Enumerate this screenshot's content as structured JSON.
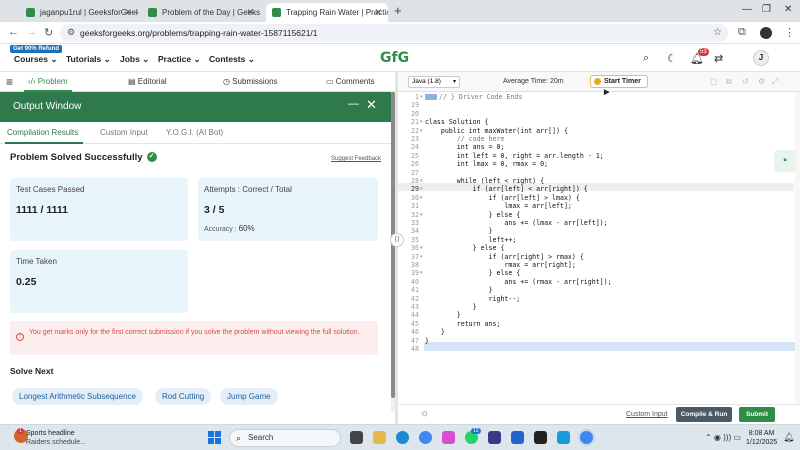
{
  "browser": {
    "tabs": [
      {
        "title": "jaganpu1rul | GeeksforGeeks Pr"
      },
      {
        "title": "Problem of the Day | GeeksforG"
      },
      {
        "title": "Trapping Rain Water | Practice"
      }
    ],
    "new_tab": "+",
    "url": "geeksforgeeks.org/problems/trapping-rain-water-1587115621/1"
  },
  "site": {
    "refund_badge": "Get 90% Refund",
    "menu": [
      "Courses",
      "Tutorials",
      "Jobs",
      "Practice",
      "Contests"
    ],
    "logo": "GfG",
    "notification_count": "53",
    "avatar_letter": "J"
  },
  "problem_toolbar": {
    "tabs": [
      "Problem",
      "Editorial",
      "Submissions",
      "Comments"
    ]
  },
  "output": {
    "title": "Output Window",
    "tabs": [
      "Compilation Results",
      "Custom Input",
      "Y.O.G.I. (AI Bot)"
    ],
    "status": "Problem Solved Successfully",
    "feedback_link": "Suggest Feedback",
    "test_cases_label": "Test Cases Passed",
    "test_cases_value": "1111 / 1111",
    "attempts_label": "Attempts : Correct / Total",
    "attempts_value": "3 / 5",
    "accuracy_label": "Accuracy :",
    "accuracy_value": "60%",
    "time_label": "Time Taken",
    "time_value": "0.25",
    "warning": "You get marks only for the first correct submission if you solve the problem without viewing the full solution.",
    "solve_next_title": "Solve Next",
    "solve_next": [
      "Longest Arithmetic Subsequence",
      "Rod Cutting",
      "Jump Game"
    ]
  },
  "editor": {
    "language": "Java (1.8)",
    "average_time": "Average Time: 20m",
    "start_timer": "Start Timer",
    "lines": [
      {
        "n": "1",
        "text": "// } Driver Code Ends",
        "cls": "cm"
      },
      {
        "n": "19",
        "text": ""
      },
      {
        "n": "20",
        "text": ""
      },
      {
        "n": "21",
        "text": "class Solution {"
      },
      {
        "n": "22",
        "text": "    public int maxWater(int arr[]) {"
      },
      {
        "n": "23",
        "text": "        // code here",
        "cls": "cm"
      },
      {
        "n": "24",
        "text": "        int ans = 0;"
      },
      {
        "n": "25",
        "text": "        int left = 0, right = arr.length - 1;"
      },
      {
        "n": "26",
        "text": "        int lmax = 0, rmax = 0;"
      },
      {
        "n": "27",
        "text": ""
      },
      {
        "n": "28",
        "text": "        while (left < right) {"
      },
      {
        "n": "29",
        "text": "            if (arr[left] < arr[right]) {"
      },
      {
        "n": "30",
        "text": "                if (arr[left] > lmax) {"
      },
      {
        "n": "31",
        "text": "                    lmax = arr[left];"
      },
      {
        "n": "32",
        "text": "                } else {"
      },
      {
        "n": "33",
        "text": "                    ans += (lmax - arr[left]);"
      },
      {
        "n": "34",
        "text": "                }"
      },
      {
        "n": "35",
        "text": "                left++;"
      },
      {
        "n": "36",
        "text": "            } else {"
      },
      {
        "n": "37",
        "text": "                if (arr[right] > rmax) {"
      },
      {
        "n": "38",
        "text": "                    rmax = arr[right];"
      },
      {
        "n": "39",
        "text": "                } else {"
      },
      {
        "n": "40",
        "text": "                    ans += (rmax - arr[right]);"
      },
      {
        "n": "41",
        "text": "                }"
      },
      {
        "n": "42",
        "text": "                right--;"
      },
      {
        "n": "43",
        "text": "            }"
      },
      {
        "n": "44",
        "text": "        }"
      },
      {
        "n": "45",
        "text": "        return ans;"
      },
      {
        "n": "46",
        "text": "    }"
      },
      {
        "n": "47",
        "text": "}"
      },
      {
        "n": "48",
        "text": ""
      }
    ],
    "custom_input": "Custom Input",
    "compile_run": "Compile & Run",
    "submit": "Submit"
  },
  "taskbar": {
    "weather_badge": "1",
    "news_title": "Sports headline",
    "news_sub": "Raiders schedule...",
    "search": "Search",
    "time": "8:08 AM",
    "date": "1/12/2025",
    "tray_badge": "12"
  }
}
